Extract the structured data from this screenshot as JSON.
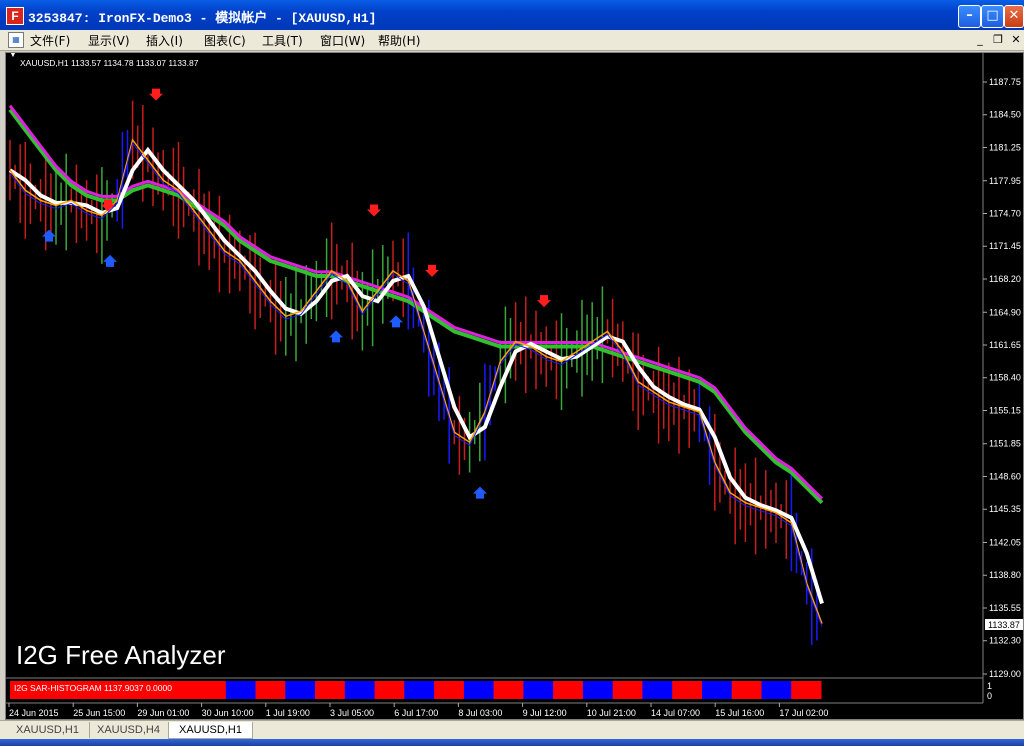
{
  "window": {
    "title": "3253847: IronFX-Demo3 - 模拟帐户 - [XAUUSD,H1]",
    "app_icon_letter": "F"
  },
  "menu": {
    "items": [
      "文件(F)",
      "显示(V)",
      "插入(I)",
      "图表(C)",
      "工具(T)",
      "窗口(W)",
      "帮助(H)"
    ]
  },
  "chart": {
    "info_line": "XAUUSD,H1  1133.57 1134.78 1133.07 1133.87",
    "watermark": "I2G Free Analyzer",
    "indicator_label": "I2G SAR-HISTOGRAM 1137.9037 0.0000",
    "indicator_scale_top": "1",
    "indicator_scale_bottom": "0",
    "current_price": "1133.87",
    "price_labels": [
      "1187.75",
      "1184.50",
      "1181.25",
      "1177.95",
      "1174.70",
      "1171.45",
      "1168.20",
      "1164.90",
      "1161.65",
      "1158.40",
      "1155.15",
      "1151.85",
      "1148.60",
      "1145.35",
      "1142.05",
      "1138.80",
      "1135.55",
      "1132.30",
      "1129.00"
    ],
    "time_labels": [
      "24 Jun 2015",
      "25 Jun 15:00",
      "29 Jun 01:00",
      "30 Jun 10:00",
      "1 Jul 19:00",
      "3 Jul 05:00",
      "6 Jul 17:00",
      "8 Jul 03:00",
      "9 Jul 12:00",
      "10 Jul 21:00",
      "14 Jul 07:00",
      "15 Jul 16:00",
      "17 Jul 02:00"
    ],
    "colors": {
      "bull": "#3aa83a",
      "bear": "#c81e1e",
      "impulse": "#1a1aff",
      "ema_slow": "#e020e0",
      "ema_slow2": "#30c030",
      "ema_mid": "#ffffff",
      "ema_fast": "#ffa000",
      "arrow_down": "#ff1e1e",
      "arrow_up": "#1e5cff",
      "histo_red": "#ff0000",
      "histo_blue": "#0000ff"
    }
  },
  "chart_data": {
    "type": "line",
    "symbol": "XAUUSD",
    "timeframe": "H1",
    "ylim": [
      1129.0,
      1187.75
    ],
    "x_labels": [
      "24 Jun 2015",
      "25 Jun 15:00",
      "29 Jun 01:00",
      "30 Jun 10:00",
      "1 Jul 19:00",
      "3 Jul 05:00",
      "6 Jul 17:00",
      "8 Jul 03:00",
      "9 Jul 12:00",
      "10 Jul 21:00",
      "14 Jul 07:00",
      "15 Jul 16:00",
      "17 Jul 02:00"
    ],
    "series": [
      {
        "name": "",
        "values": [
          1179,
          1177,
          1176,
          1175.5,
          1176,
          1175,
          1174.5,
          1176,
          1182,
          1180,
          1178,
          1177,
          1175,
          1173,
          1171,
          1170,
          1168,
          1166,
          1164.5,
          1165,
          1167,
          1169,
          1168,
          1165,
          1167,
          1169,
          1168,
          1163,
          1158,
          1153,
          1152,
          1155,
          1160,
          1162,
          1161.5,
          1160.5,
          1160,
          1161,
          1162,
          1163,
          1161,
          1158,
          1157,
          1156,
          1155.5,
          1155,
          1150,
          1147,
          1146,
          1145.5,
          1145,
          1144,
          1138,
          1134
        ]
      },
      {
        "name": "",
        "values": [
          1185,
          1183,
          1181,
          1179,
          1177.5,
          1176.5,
          1176,
          1176,
          1177,
          1177.5,
          1177,
          1176.5,
          1175.5,
          1174.5,
          1173.5,
          1172,
          1171,
          1170,
          1169.5,
          1169,
          1168.5,
          1168.5,
          1168,
          1167.5,
          1167,
          1166.5,
          1166,
          1165,
          1164,
          1163,
          1162.5,
          1162,
          1161.5,
          1161.5,
          1161.5,
          1161.5,
          1161.5,
          1161.5,
          1161.5,
          1161,
          1160.5,
          1160,
          1159.5,
          1159,
          1158.5,
          1158,
          1157,
          1155,
          1153,
          1151.5,
          1150,
          1149,
          1147.5,
          1146
        ]
      }
    ],
    "arrows_down_approx_prices": [
      1186.5,
      1175.5,
      1175,
      1169,
      1166
    ],
    "arrows_up_approx_prices": [
      1172.5,
      1170,
      1164,
      1162.5,
      1147
    ],
    "histogram_segments": [
      "red",
      "blue",
      "red",
      "blue",
      "red",
      "blue",
      "red",
      "blue",
      "red",
      "blue",
      "red",
      "blue",
      "red",
      "blue",
      "red",
      "blue",
      "red",
      "blue",
      "red",
      "blue",
      "red"
    ]
  },
  "tabs": {
    "items": [
      "XAUUSD,H1",
      "XAUUSD,H4",
      "XAUUSD,H1"
    ],
    "active_index": 2
  }
}
